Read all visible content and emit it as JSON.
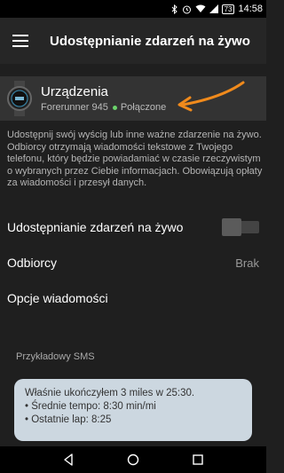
{
  "status_bar": {
    "battery": "73",
    "time": "14:58"
  },
  "app_bar": {
    "title": "Udostępnianie zdarzeń na żywo",
    "menu_icon": "hamburger-menu-icon"
  },
  "device": {
    "name": "Urządzenia",
    "model": "Forerunner 945",
    "status": "Połączone",
    "status_color": "#6bd36b"
  },
  "description": "Udostępnij swój wyścig lub inne ważne zdarzenie na żywo. Odbiorcy otrzymają wiadomości tekstowe z Twojego telefonu, który będzie powiadamiać w czasie rzeczywistym o wybranych przez Ciebie informacjach. Obowiązują opłaty za wiadomości i przesył danych.",
  "settings": {
    "live_sharing_label": "Udostępnianie zdarzeń na żywo",
    "live_sharing_on": false,
    "recipients_label": "Odbiorcy",
    "recipients_value": "Brak",
    "message_options_label": "Opcje wiadomości"
  },
  "sms_preview": {
    "label": "Przykładowy SMS",
    "lines": [
      "Właśnie ukończyłem 3 miles w 25:30.",
      "• Średnie tempo: 8:30 min/mi",
      "• Ostatnie lap: 8:25"
    ]
  },
  "colors": {
    "annotation_arrow": "#f08a1c",
    "sms_bubble": "#ccd7e0"
  }
}
